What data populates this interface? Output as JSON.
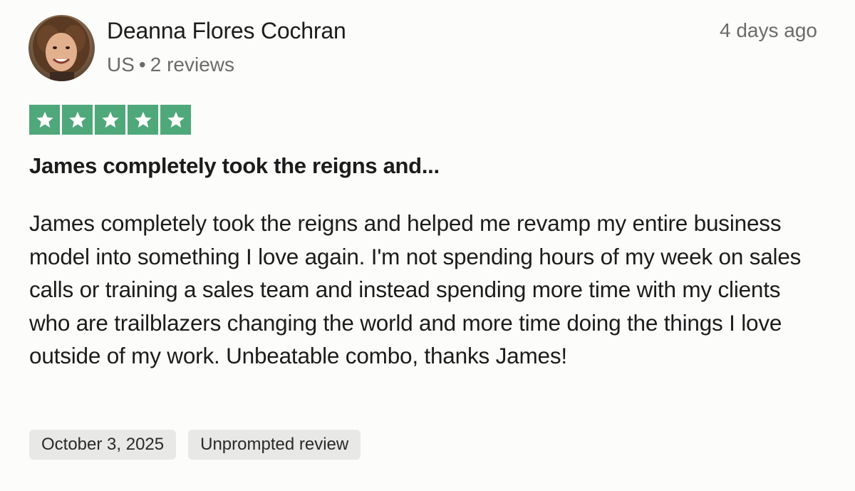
{
  "reviewer": {
    "name": "Deanna Flores Cochran",
    "country": "US",
    "separator": "•",
    "reviews_count": "2 reviews"
  },
  "time_ago": "4 days ago",
  "rating": {
    "stars": 5,
    "max": 5,
    "color": "#4fa87a"
  },
  "review": {
    "title": "James completely took the reigns and...",
    "body": "James completely took the reigns and helped me revamp my entire business model into something I love again. I'm not spending hours of my week on sales calls or training a sales team and instead spending more time with my clients who are trailblazers changing the world and more time doing the things I love outside of my work. Unbeatable combo, thanks James!"
  },
  "chips": {
    "date": "October 3, 2025",
    "type": "Unprompted review"
  },
  "icons": {
    "avatar": "reviewer-avatar",
    "star": "star-icon"
  }
}
